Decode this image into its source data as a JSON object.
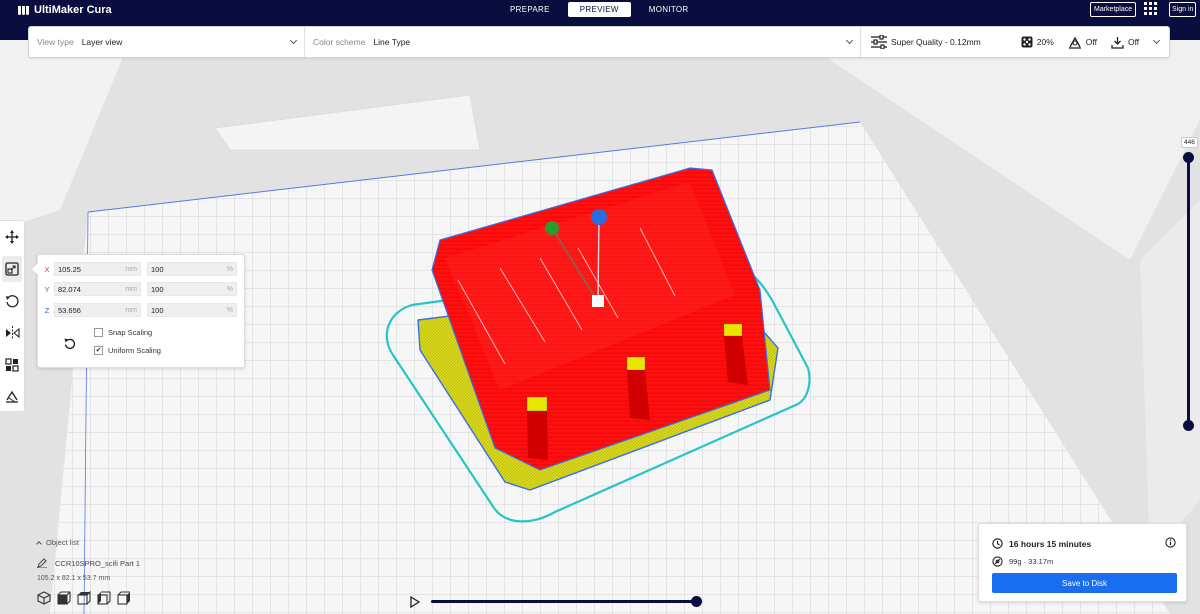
{
  "app": {
    "title": "UltiMaker Cura"
  },
  "header": {
    "tabs": [
      {
        "label": "PREPARE",
        "active": false
      },
      {
        "label": "PREVIEW",
        "active": true
      },
      {
        "label": "MONITOR",
        "active": false
      }
    ],
    "marketplace_label": "Marketplace",
    "signin_label": "Sign in"
  },
  "view_panel": {
    "view_type": {
      "label": "View type",
      "value": "Layer view"
    },
    "color_scheme": {
      "label": "Color scheme",
      "value": "Line Type"
    },
    "print_setup": {
      "quality": "Super Quality - 0.12mm",
      "infill": "20%",
      "support": "Off",
      "adhesion": "Off"
    }
  },
  "scale_tool": {
    "x": {
      "axis": "X",
      "mm": "105.25",
      "pct": "100"
    },
    "y": {
      "axis": "Y",
      "mm": "82.074",
      "pct": "100"
    },
    "z": {
      "axis": "Z",
      "mm": "53.656",
      "pct": "100"
    },
    "unit_mm": "mm",
    "unit_pct": "%",
    "snap_scaling": {
      "label": "Snap Scaling",
      "checked": false
    },
    "uniform_scaling": {
      "label": "Uniform Scaling",
      "checked": true
    }
  },
  "object_list": {
    "header": "Object list",
    "object_name": "CCR10SPRO_scifi Part 1",
    "dimensions": "105.2 x 82.1 x 53.7 mm"
  },
  "layer_slider": {
    "current_layer": "446",
    "min_layer": 1,
    "max_layer": 446
  },
  "simulation": {
    "progress": 1.0
  },
  "print_info": {
    "time": "16 hours 15 minutes",
    "material": "99g · 33.17m",
    "save_label": "Save to Disk"
  },
  "colors": {
    "header_bg": "#0a0e3e",
    "accent": "#196ef0",
    "model_wall": "#ff0000",
    "model_infill": "#d4d400",
    "outline": "#3b6ee8",
    "skirt": "#27c4c9"
  },
  "icons": [
    "move-icon",
    "scale-icon",
    "rotate-icon",
    "mirror-icon",
    "per-model-settings-icon",
    "support-blocker-icon"
  ]
}
